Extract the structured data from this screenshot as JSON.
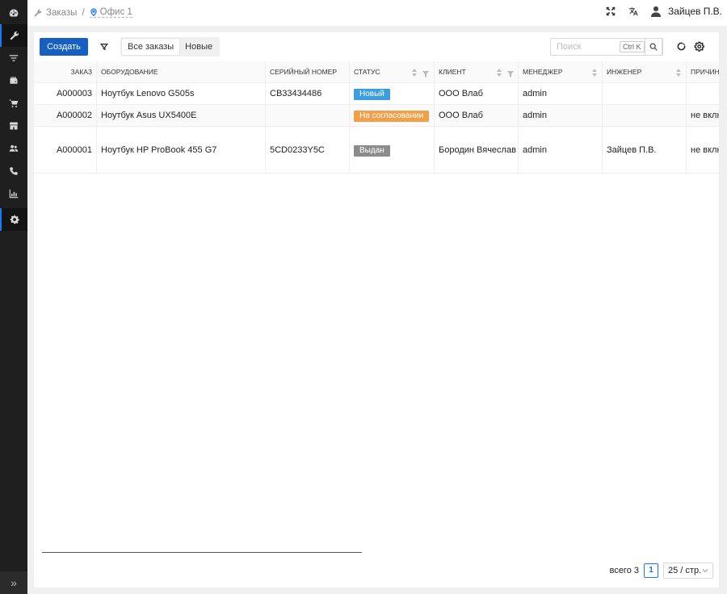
{
  "sidebar": {
    "items": [
      {
        "icon": "dashboard-icon"
      },
      {
        "icon": "wrench-icon",
        "active": true
      },
      {
        "icon": "filter-list-icon"
      },
      {
        "icon": "wallet-icon"
      },
      {
        "icon": "cart-icon"
      },
      {
        "icon": "store-icon"
      },
      {
        "icon": "users-icon"
      },
      {
        "icon": "phone-icon"
      },
      {
        "icon": "chart-icon"
      },
      {
        "icon": "gear-icon"
      }
    ],
    "expand_label": "»"
  },
  "header": {
    "breadcrumb": {
      "section": "Заказы",
      "separator": "/",
      "office": "Офис 1"
    },
    "user_name": "Зайцев П.В."
  },
  "toolbar": {
    "create_label": "Создать",
    "segments": [
      {
        "label": "Все заказы",
        "selected": true
      },
      {
        "label": "Новые",
        "selected": false
      }
    ],
    "search": {
      "placeholder": "Поиск",
      "shortcut": "Ctrl K",
      "value": ""
    }
  },
  "table": {
    "columns": [
      "Заказ",
      "Оборудование",
      "Серийный номер",
      "Статус",
      "Клиент",
      "Менеджер",
      "Инженер",
      "Причина"
    ],
    "rows": [
      {
        "order": "A000003",
        "equipment": "Ноутбук Lenovo G505s",
        "serial": "CB33434486",
        "status": "Новый",
        "status_color": "#3a9ee0",
        "client": "ООО Влаб",
        "manager": "admin",
        "engineer": "",
        "reason": ""
      },
      {
        "order": "A000002",
        "equipment": "Ноутбук Asus UX5400E",
        "serial": "",
        "status": "На согласовании",
        "status_color": "#f0a04b",
        "client": "ООО Влаб",
        "manager": "admin",
        "engineer": "",
        "reason": "не вклю"
      },
      {
        "order": "A000001",
        "equipment": "Ноутбук HP ProBook 455 G7",
        "serial": "5CD0233Y5C",
        "status": "Выдан",
        "status_color": "#8c8c8c",
        "client": "Бородин Вячеслав",
        "manager": "admin",
        "engineer": "Зайцев П.В.",
        "reason": "не вклю"
      }
    ]
  },
  "pagination": {
    "total_label": "всего 3",
    "current_page": "1",
    "page_size": "25 / стр."
  },
  "colors": {
    "accent": "#1677ff",
    "primary_button": "#1660c4",
    "sidebar_bg": "#1f1f1f"
  }
}
